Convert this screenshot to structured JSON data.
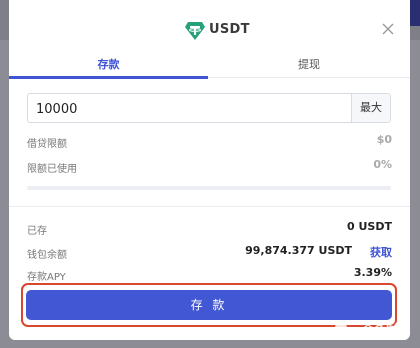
{
  "modal": {
    "token_icon": "tether-shield-icon",
    "title": "USDT",
    "close_icon": "close-icon"
  },
  "tabs": [
    {
      "label": "存款",
      "active": true
    },
    {
      "label": "提现",
      "active": false
    }
  ],
  "amount": {
    "value": "10000",
    "max_label": "最大"
  },
  "credit": {
    "limit_label": "借贷限额",
    "limit_value": "$0",
    "used_label": "限额已使用",
    "used_value": "0%",
    "used_fraction": 0
  },
  "summary": {
    "deposited_label": "已存",
    "deposited_value": "0 USDT",
    "wallet_label": "钱包余额",
    "wallet_value": "99,874.377 USDT",
    "get_label": "获取",
    "apy_label": "存款APY",
    "apy_value": "3.39%"
  },
  "deposit_button": "存 款",
  "watermark": "金色财经",
  "colors": {
    "accent": "#4257d3",
    "highlight_frame": "#d9472f",
    "tether": "#26a17b"
  }
}
